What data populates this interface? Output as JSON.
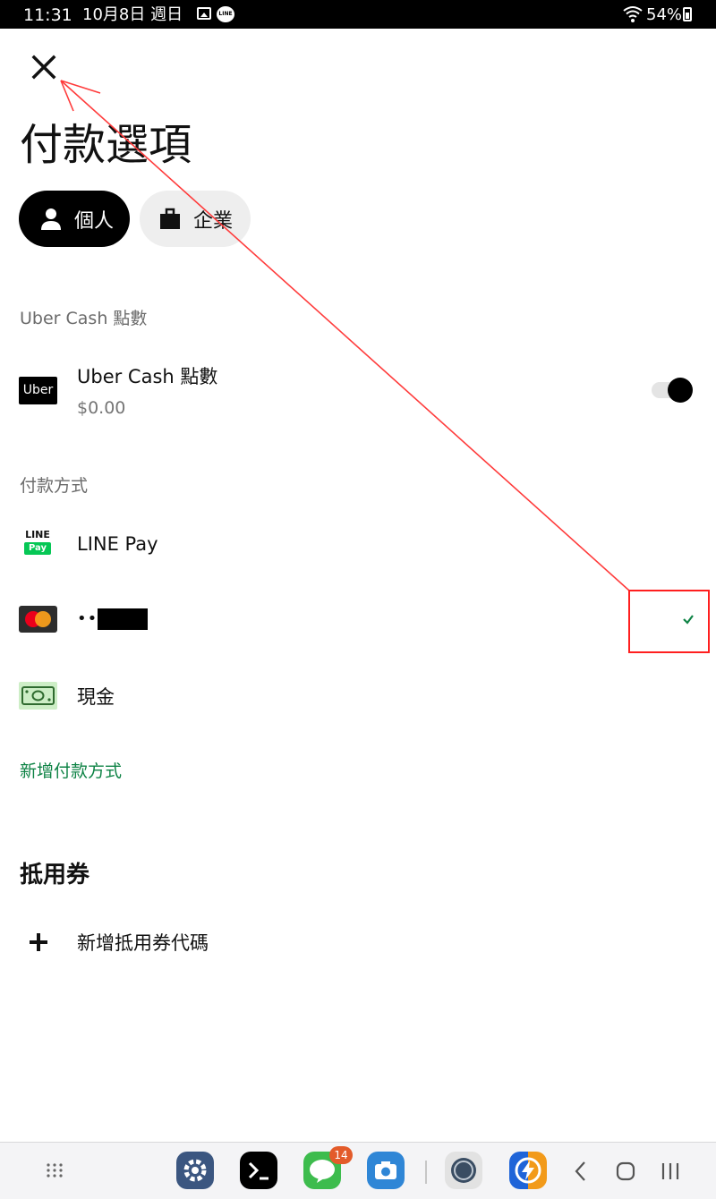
{
  "status_bar": {
    "time": "11:31",
    "date": "10月8日 週日",
    "line_icon_text": "LINE",
    "battery": "54%"
  },
  "header": {
    "close_icon": "close-icon",
    "title": "付款選項"
  },
  "tabs": [
    {
      "label": "個人",
      "icon": "person-icon",
      "selected": true
    },
    {
      "label": "企業",
      "icon": "briefcase-icon",
      "selected": false
    }
  ],
  "uber_cash": {
    "section_label": "Uber Cash 點數",
    "logo_text": "Uber",
    "title": "Uber Cash 點數",
    "amount": "$0.00",
    "toggle_on": true
  },
  "payment_methods": {
    "section_label": "付款方式",
    "items": [
      {
        "label": "LINE Pay",
        "icon": "line-pay-icon",
        "logo_top": "LINE",
        "logo_bottom": "Pay"
      },
      {
        "label": "••••",
        "icon": "mastercard-icon",
        "selected": true
      },
      {
        "label": "現金",
        "icon": "cash-icon"
      }
    ],
    "add_link": "新增付款方式"
  },
  "vouchers": {
    "heading": "抵用券",
    "add_label": "新增抵用券代碼"
  },
  "taskbar": {
    "line_badge": "14",
    "apps": [
      "settings-app",
      "terminal-app",
      "line-app",
      "camera-app",
      "jg-app",
      "bolt-app"
    ]
  },
  "colors": {
    "accent_green": "#0e8345",
    "annotation_red": "#ff3b3b",
    "primary": "#000000"
  }
}
